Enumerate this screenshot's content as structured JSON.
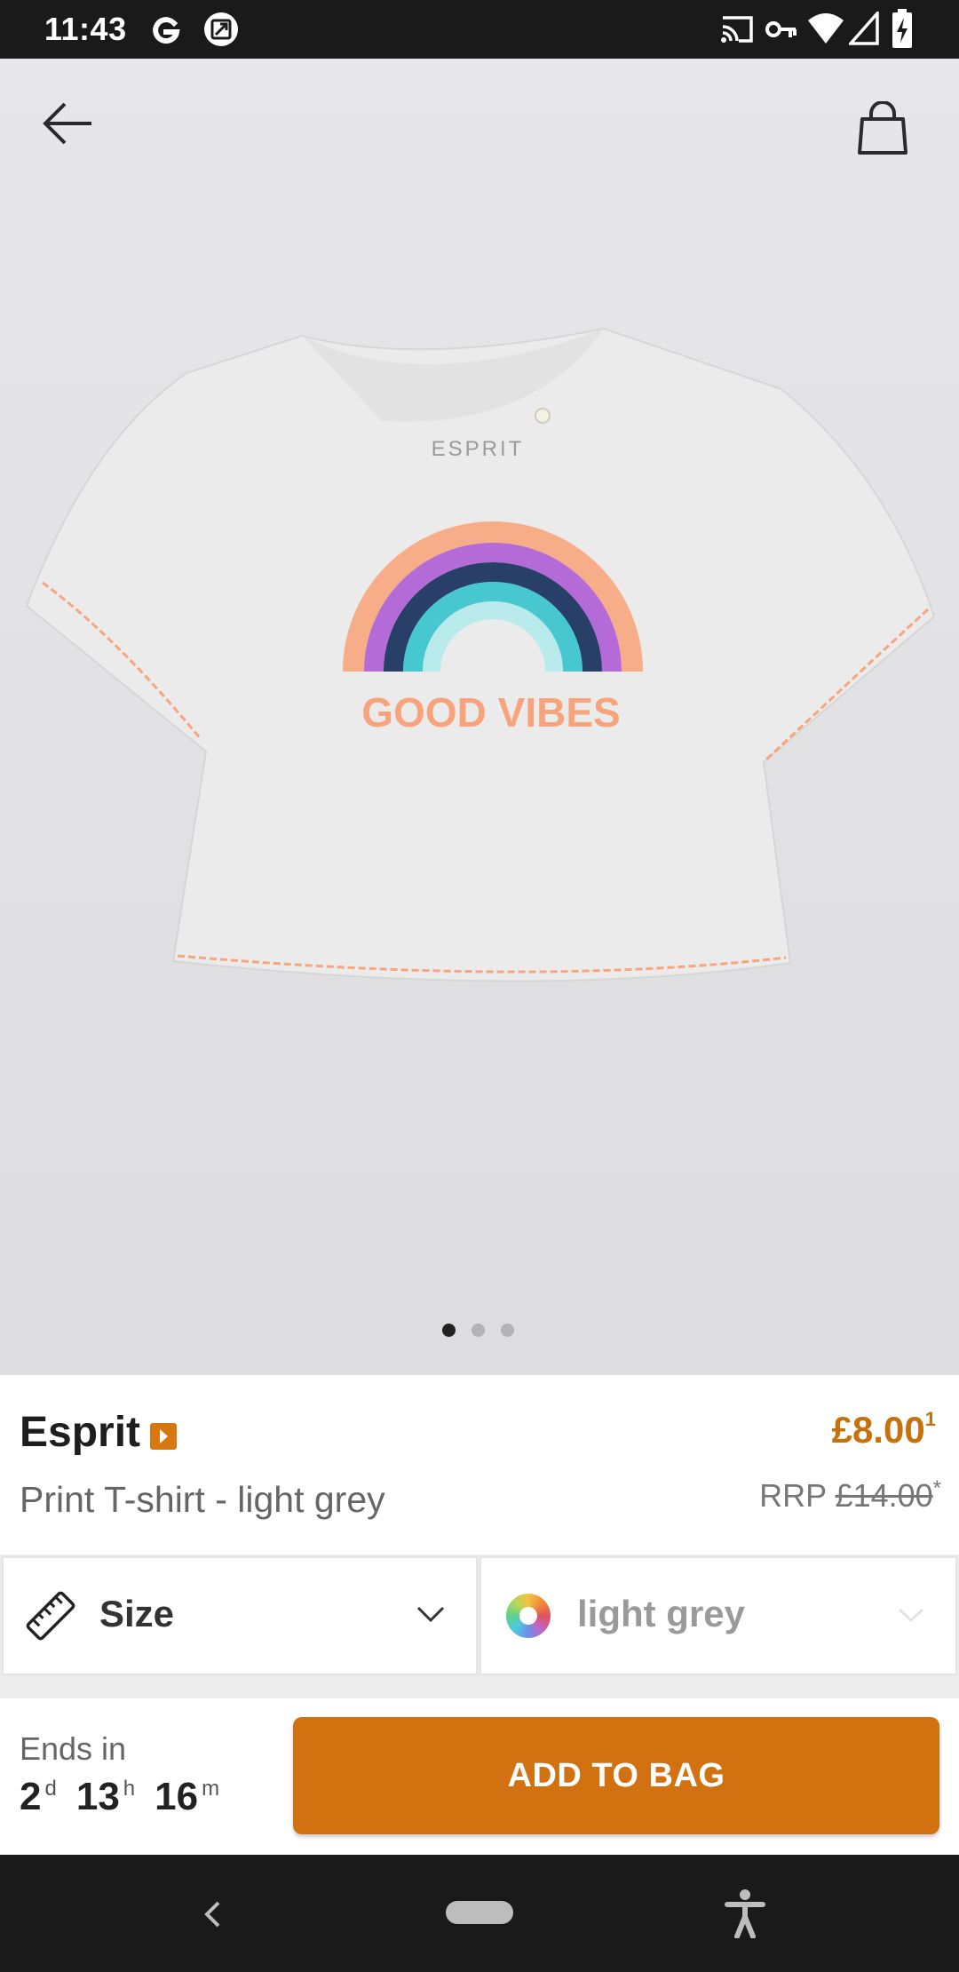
{
  "status_bar": {
    "time": "11:43"
  },
  "product": {
    "brand": "Esprit",
    "title": "Print T-shirt - light grey",
    "price": "£8.00",
    "price_footnote": "1",
    "rrp_label": "RRP",
    "rrp_price": "£14.00",
    "rrp_footnote": "*",
    "print_text": "GOOD VIBES",
    "print_brand": "ESPRIT",
    "image_dots": 3,
    "active_image": 1
  },
  "selectors": {
    "size_label": "Size",
    "color_label": "light grey"
  },
  "bottom_bar": {
    "ends_label": "Ends in",
    "days": "2",
    "days_unit": "d",
    "hours": "13",
    "hours_unit": "h",
    "minutes": "16",
    "minutes_unit": "m",
    "add_to_bag_label": "ADD TO BAG"
  },
  "colors": {
    "accent": "#d27110",
    "price": "#c6710b"
  },
  "icons": [
    "g-icon",
    "screenshot-icon",
    "cast-icon",
    "vpn-key-icon",
    "wifi-icon",
    "signal-icon",
    "battery-charging-icon",
    "back-arrow-icon",
    "shopping-bag-icon",
    "ruler-icon",
    "chevron-down-icon",
    "color-wheel-icon",
    "nav-back-icon",
    "nav-home-icon",
    "accessibility-icon"
  ]
}
